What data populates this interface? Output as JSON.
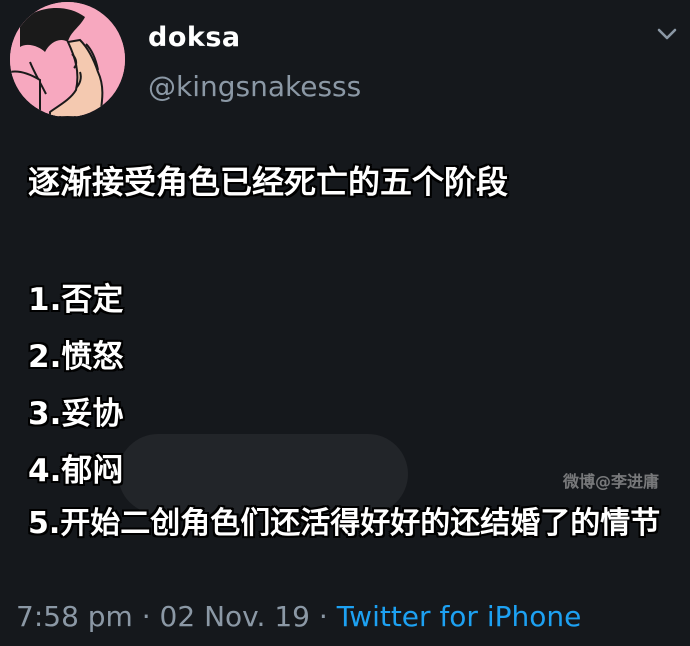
{
  "author": {
    "display_name": "doksa",
    "handle": "@kingsnakesss"
  },
  "icons": {
    "menu": "chevron-down-icon",
    "avatar": "avatar-image"
  },
  "content": {
    "title": "逐渐接受角色已经死亡的五个阶段",
    "items": [
      "1.否定",
      "2.愤怒",
      "3.妥协",
      "4.郁闷",
      "5.开始二创角色们还活得好好的还结婚了的情节"
    ]
  },
  "watermark": "微博@李进庸",
  "meta": {
    "time": "7:58 pm",
    "date": "02 Nov. 19",
    "separator": "·",
    "source": "Twitter for iPhone"
  },
  "colors": {
    "background": "#15181c",
    "secondary_text": "#8b98a5",
    "link": "#1da1f2",
    "avatar_bg": "#f7a8bf"
  }
}
